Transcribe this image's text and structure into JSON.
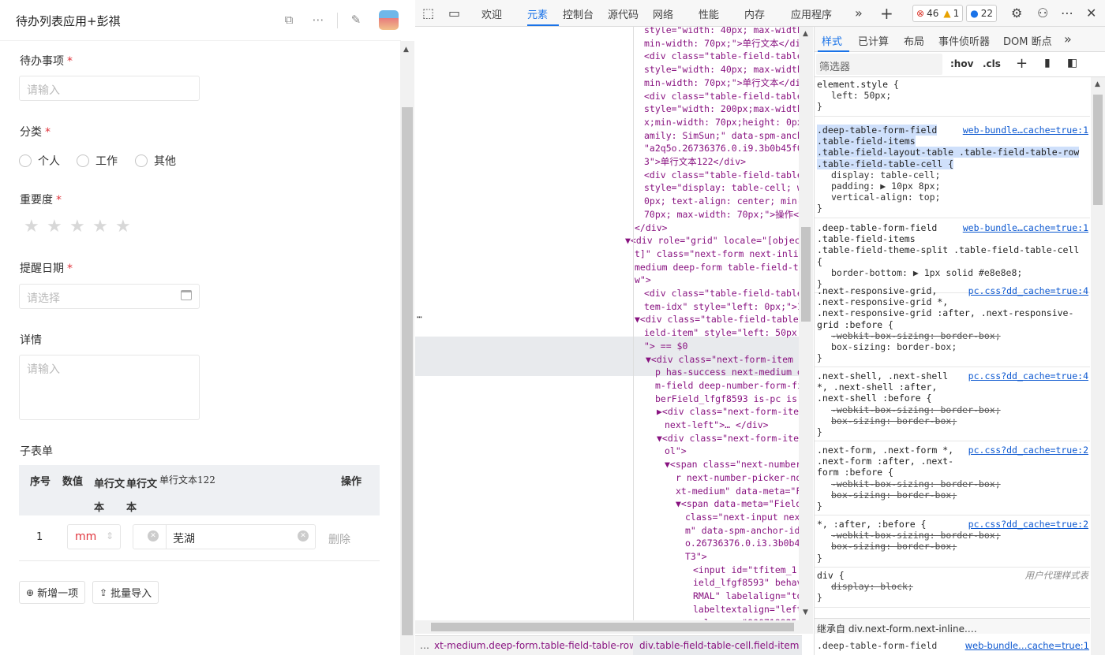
{
  "app": {
    "title": "待办列表应用+彭祺",
    "fields": {
      "todo_label": "待办事项",
      "todo_placeholder": "请输入",
      "category_label": "分类",
      "category_options": [
        "个人",
        "工作",
        "其他"
      ],
      "importance_label": "重要度",
      "importance_rating": 0,
      "importance_max": 5,
      "reminder_label": "提醒日期",
      "reminder_placeholder": "请选择",
      "detail_label": "详情",
      "detail_placeholder": "请输入",
      "required_mark": "*"
    },
    "subform": {
      "label": "子表单",
      "headers": [
        "序号",
        "数值",
        "单行文本",
        "单行文本",
        "单行文本122",
        "操作"
      ],
      "row": {
        "index": "1",
        "number_value": "mm",
        "text_value": "芜湖",
        "delete_label": "删除"
      },
      "add_label": "新增一项",
      "import_label": "批量导入"
    }
  },
  "devtools": {
    "tabs": [
      "欢迎",
      "元素",
      "控制台",
      "源代码",
      "网络",
      "性能",
      "内存",
      "应用程序"
    ],
    "active_tab": "元素",
    "errors": "46",
    "warnings": "1",
    "issues": "22",
    "styles_tabs": [
      "样式",
      "已计算",
      "布局",
      "事件侦听器",
      "DOM 断点"
    ],
    "filter_placeholder": "筛选器",
    "hov": ":hov",
    "cls": ".cls",
    "breadcrumb": [
      "xt-medium.deep-form.table-field-table-row",
      "div.table-field-table-cell.field-item"
    ],
    "elements_lines": [
      "style=\"width: 40px; max-width",
      "min-width: 70px;\">单行文本</di",
      "<div class=\"table-field-table",
      "style=\"width: 40px; max-width",
      "min-width: 70px;\">单行文本</di",
      "<div class=\"table-field-table",
      "style=\"width: 200px;max-width",
      "x;min-width: 70px;height: 0px",
      "amily: SimSun;\" data-spm-anch",
      "\"a2q5o.26736376.0.i9.3b0b45f0",
      "3\">单行文本122</div>",
      "<div class=\"table-field-table",
      "style=\"display: table-cell; w",
      "0px; text-align: center; min-",
      "70px; max-width: 70px;\">操作<",
      "</div>",
      "▼<div role=\"grid\" locale=\"[objec",
      "t]\" class=\"next-form next-inlin",
      "medium deep-form table-field-ta",
      "w\">",
      "<div class=\"table-field-table",
      "tem-idx\" style=\"left: 0px;\">1",
      "▼<div class=\"table-field-table",
      "ield-item\" style=\"left: 50px;",
      "\"> == $0",
      "▼<div class=\"next-form-item",
      "p has-success next-medium d",
      "m-field deep-number-form-fi",
      "berField_lfgf8593 is-pc is-",
      "▶<div class=\"next-form-iter",
      "next-left\">… </div>",
      "▼<div class=\"next-form-iter",
      "ol\">",
      "▼<span class=\"next-number",
      "r next-number-picker-nor",
      "xt-medium\" data-meta=\"F:",
      "▼<span data-meta=\"Field",
      "class=\"next-input next",
      "m\" data-spm-anchor-id=",
      "o.26736376.0.i3.3b0b45",
      "T3\">",
      "<input id=\"tfitem_1.",
      "ield_lfgf8593\" behav",
      "RMAL\" labelalign=\"to",
      "labeltextalign=\"left",
      "valuemax=\"9007199254"
    ],
    "styles_rules": [
      {
        "sel": [
          "element.style {"
        ],
        "src": "",
        "decls": [
          "left: 50px;"
        ],
        "strike": [
          false
        ]
      },
      {
        "sel": [
          ".deep-table-form-field",
          ".table-field-items",
          ".table-field-layout-table .table-field-table-row",
          ".table-field-table-cell {"
        ],
        "src": "web-bundle…cache=true:1",
        "decls": [
          "display: table-cell;",
          "padding: ▶ 10px 8px;",
          "vertical-align: top;"
        ],
        "strike": [
          false,
          false,
          false
        ]
      },
      {
        "sel": [
          ".deep-table-form-field",
          ".table-field-items",
          ".table-field-theme-split .table-field-table-cell {"
        ],
        "src": "web-bundle…cache=true:1",
        "decls": [
          "border-bottom: ▶ 1px solid  #e8e8e8;"
        ],
        "strike": [
          false
        ]
      },
      {
        "sel": [
          ".next-responsive-grid,",
          ".next-responsive-grid *,",
          ".next-responsive-grid :after, .next-responsive-",
          "grid :before {"
        ],
        "src": "pc.css?dd_cache=true:4",
        "decls": [
          "-webkit-box-sizing: border-box;",
          "box-sizing: border-box;"
        ],
        "strike": [
          true,
          false
        ]
      },
      {
        "sel": [
          ".next-shell, .next-shell",
          "*, .next-shell :after,",
          ".next-shell :before {"
        ],
        "src": "pc.css?dd_cache=true:4",
        "decls": [
          "-webkit-box-sizing: border-box;",
          "box-sizing: border-box;"
        ],
        "strike": [
          true,
          true
        ]
      },
      {
        "sel": [
          ".next-form, .next-form *,",
          ".next-form :after, .next-",
          "form :before {"
        ],
        "src": "pc.css?dd_cache=true:2",
        "decls": [
          "-webkit-box-sizing: border-box;",
          "box-sizing: border-box;"
        ],
        "strike": [
          true,
          true
        ]
      },
      {
        "sel": [
          "*, :after, :before {"
        ],
        "src": "pc.css?dd_cache=true:2",
        "decls": [
          "-webkit-box-sizing: border-box;",
          "box-sizing: border-box;"
        ],
        "strike": [
          true,
          true
        ]
      },
      {
        "sel": [
          "div {"
        ],
        "src": "用户代理样式表",
        "decls": [
          "display: block;"
        ],
        "strike": [
          true
        ]
      }
    ],
    "inherited": "继承自 div.next-form.next-inline.…",
    "last_rule_sel": [
      ".deep-table-form-field",
      ".table-field-items"
    ],
    "last_rule_src": "web-bundle…cache=true:1"
  }
}
